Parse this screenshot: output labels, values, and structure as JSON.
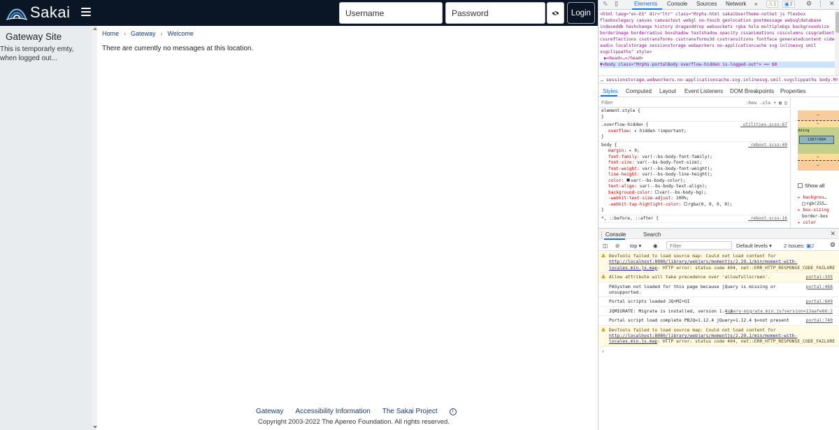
{
  "header": {
    "logo_text": "Sakai",
    "username_placeholder": "Username",
    "password_placeholder": "Password",
    "login_label": "Login"
  },
  "sidebar": {
    "title": "Gateway Site",
    "description": "This is temporarly emty, when logged out..."
  },
  "breadcrumb": [
    "Home",
    "Gateway",
    "Welcome"
  ],
  "main": {
    "message": "There are currently no messages at this location."
  },
  "footer": {
    "links": [
      "Gateway",
      "Accessibility Information",
      "The Sakai Project"
    ],
    "copyright": "Copyright 2003-2022 The Apereo Foundation. All rights reserved."
  },
  "devtools": {
    "tabs": [
      "Elements",
      "Console",
      "Sources",
      "Network"
    ],
    "more": "»",
    "warn_count": "1",
    "info_count": "2",
    "elements": {
      "html_line": "<html lang=\"en-ES\" dir=\"ltr\" class=\"Mrphs-html sakaiUserTheme-notSet js flexbox flexboxlegacy canvas canvastext webgl no-touch geolocation postmessage websqldatabase indexeddb hashchange history draganddrop websockets rgba hsla multiplebgs backgroundsize borderimage borderradius boxshadow textshadow opacity cssanimations csscolumns cssgradients cssreflections csstransforms csstransforms3d csstransitions fontface generatedcontent video audio localstorage sessionstorage webworkers no-applicationcache svg inlinesvg smil svgclippaths\" style>",
      "head_line": "▶<head>…</head>",
      "body_line": "▼<body class=\"Mrphs-portalBody overflow-hidden is-logged-out\"> == $0",
      "crumb": "…  sessionstorage.webworkers.no-applicationcache.svg.inlinesvg.smil.svgclippaths   body.Mr"
    },
    "styles_tabs": [
      "Styles",
      "Computed",
      "Layout",
      "Event Listeners",
      "DOM Breakpoints",
      "Properties"
    ],
    "filter_placeholder": "Filter",
    "filter_tools": [
      ":hov",
      ".cls",
      "+"
    ],
    "rules": [
      {
        "selector": "element.style {",
        "source": "",
        "decls": [],
        "close": "}"
      },
      {
        "selector": ".overflow-hidden {",
        "source": "_utilities.scss:67",
        "decls": [
          {
            "p": "overflow:",
            "v": "▸ hidden !important;"
          }
        ],
        "close": "}"
      },
      {
        "selector": "body {",
        "source": "_reboot.scss:49",
        "decls": [
          {
            "p": "margin:",
            "v": "▸ 0;"
          },
          {
            "p": "font-family:",
            "v": "var(--bs-body-font-family);"
          },
          {
            "p": "font-size:",
            "v": "var(--bs-body-font-size);"
          },
          {
            "p": "font-weight:",
            "v": "var(--bs-body-font-weight);"
          },
          {
            "p": "line-height:",
            "v": "var(--bs-body-line-height);"
          },
          {
            "p": "color:",
            "v": "var(--bs-body-color);"
          },
          {
            "p": "text-align:",
            "v": "var(--bs-body-text-align);"
          },
          {
            "p": "background-color:",
            "v": "var(--bs-body-bg);"
          },
          {
            "p": "-webkit-text-size-adjust:",
            "v": "100%;"
          },
          {
            "p": "-webkit-tap-highlight-color:",
            "v": "rgba(0, 0, 0, 0);"
          }
        ],
        "close": "}"
      },
      {
        "selector": "*, ::before, ::after {",
        "source": "_reboot.scss:16",
        "decls": [],
        "close": ""
      }
    ],
    "box_model": {
      "label": "dding",
      "content": "1367×984",
      "dash": "–"
    },
    "computed": {
      "show_all": "Show all",
      "items": [
        {
          "p": "▸ backgrou…",
          "v": "rgb(255…"
        },
        {
          "p": "▸ box-sizing",
          "v": "border-box"
        },
        {
          "p": "▸ color",
          "v": ""
        }
      ]
    },
    "console": {
      "tabs": [
        "Console",
        "Search"
      ],
      "context": "top ▾",
      "filter_placeholder": "Filter",
      "levels": "Default levels ▾",
      "issues": "2 Issues:",
      "issues_count": "2",
      "messages": [
        {
          "type": "warn",
          "text": "DevTools failed to load source map: Could not load content for ",
          "link": "http://localhost:8080/library/webjars/momentjs/2.29.1/min/moment-with-locales.min.js.map",
          "tail": ": HTTP error: status code 404, net::ERR_HTTP_RESPONSE_CODE_FAILURE",
          "src": ""
        },
        {
          "type": "warn",
          "text": "Allow attribute will take precedence over 'allowfullscreen'.",
          "link": "",
          "tail": "",
          "src": "portal:335"
        },
        {
          "type": "log",
          "text": "PASystem not loaded for this page because jQuery is missing or unsupported.",
          "link": "",
          "tail": "",
          "src": "portal:468"
        },
        {
          "type": "log",
          "text": "Portal scripts loaded JQ+MI+UI",
          "link": "",
          "tail": "",
          "src": "portal:649"
        },
        {
          "type": "log",
          "text": "JQMIGRATE: Migrate is installed, version 1.4.1",
          "link": "",
          "tail": "",
          "src": "jquery-migrate.min.js?version=13aafe66:2"
        },
        {
          "type": "log",
          "text": "Portal script load complete PBJQ=1.12.4 jQuery=1.12.4 $=not present",
          "link": "",
          "tail": "",
          "src": "portal:740"
        },
        {
          "type": "warn",
          "text": "DevTools failed to load source map: Could not load content for ",
          "link": "http://localhost:8080/library/webjars/momentjs/2.29.1/min/moment-with-locales.min.js.map",
          "tail": ": HTTP error: status code 404, net::ERR_HTTP_RESPONSE_CODE_FAILURE",
          "src": ""
        }
      ],
      "prompt": "›"
    }
  },
  "colors": {
    "topbar": "#0a1626",
    "link": "#1a3a6a",
    "sidebar_bg": "#e9ecef",
    "devtools_accent": "#1a73e8",
    "warn_bg": "#fffbe5"
  }
}
